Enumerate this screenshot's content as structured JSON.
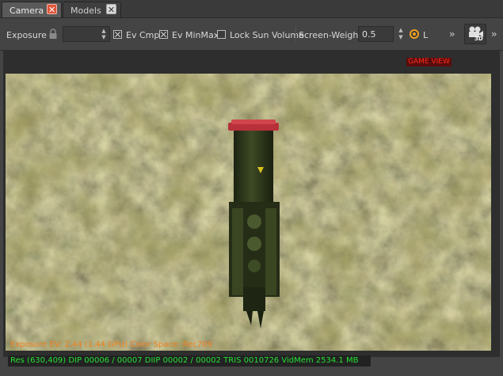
{
  "tabs": [
    {
      "label": "Camera",
      "active": true
    },
    {
      "label": "Models",
      "active": false
    }
  ],
  "toolbar": {
    "exposure_label": "Exposure",
    "exposure_value": "",
    "ev_cmp_label": "Ev Cmp",
    "ev_cmp_checked": true,
    "ev_minmax_label": "Ev MinMax",
    "ev_minmax_checked": true,
    "lock_sun_label": "Lock Sun Volume",
    "lock_sun_checked": false,
    "screen_weight_label": "Screen-Weight",
    "screen_weight_value": "0.5",
    "radio_label": "L",
    "camera_badge": "3D"
  },
  "viewport": {
    "game_view_label": "GAME VIEW",
    "exposure_text": "Exposure EV: 2.44 (1.44 GPU)  Color Space: Rec709"
  },
  "status": {
    "text": "Res (630,409)   DIP 00006 / 00007   DIIP 00002 / 00002   TRIS 0010726   VidMem 2534.1 MB"
  },
  "colors": {
    "accent_tab_close": "#e0573a",
    "radio_ring": "#f0a020",
    "status_text": "#25e034",
    "overlay_text": "#f08020",
    "game_view_text": "#ff2a1d"
  }
}
